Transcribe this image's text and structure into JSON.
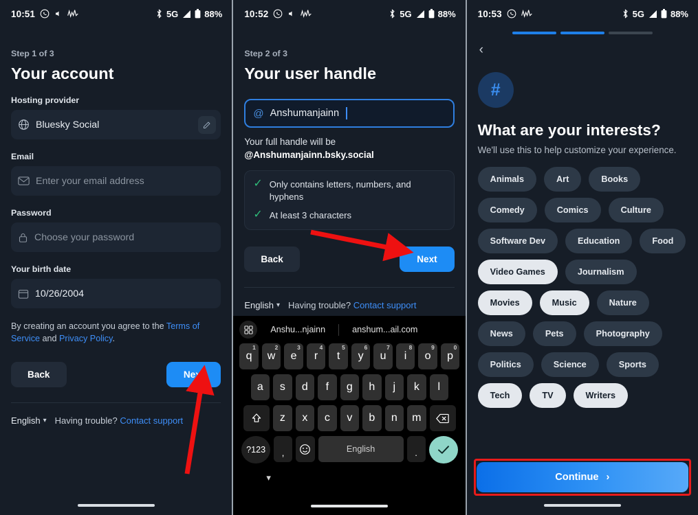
{
  "panels": [
    {
      "statusbar": {
        "time": "10:51",
        "left_icons": [
          "whatsapp-icon",
          "mute-icon",
          "pulse-icon"
        ],
        "network": "5G",
        "battery": "88%",
        "right_icons": [
          "bluetooth-icon",
          "signal-icon",
          "battery-icon"
        ]
      },
      "step": "Step 1 of 3",
      "title": "Your account",
      "fields": {
        "hosting_label": "Hosting provider",
        "hosting_value": "Bluesky Social",
        "email_label": "Email",
        "email_placeholder": "Enter your email address",
        "password_label": "Password",
        "password_placeholder": "Choose your password",
        "birth_label": "Your birth date",
        "birth_value": "10/26/2004"
      },
      "terms": {
        "prefix": "By creating an account you agree to the ",
        "tos": "Terms of Service",
        "middle": " and ",
        "privacy": "Privacy Policy",
        "suffix": "."
      },
      "back_label": "Back",
      "next_label": "Next",
      "footer": {
        "language": "English",
        "help": "Having trouble?",
        "contact": "Contact support"
      }
    },
    {
      "statusbar": {
        "time": "10:52",
        "left_icons": [
          "whatsapp-icon",
          "mute-icon",
          "pulse-icon"
        ],
        "network": "5G",
        "battery": "88%",
        "right_icons": [
          "bluetooth-icon",
          "signal-icon",
          "battery-icon"
        ]
      },
      "step": "Step 2 of 3",
      "title": "Your user handle",
      "handle_value": "Anshumanjainn",
      "full_handle_prefix": "Your full handle will be ",
      "full_handle_value": "@Anshumanjainn.bsky.social",
      "rules": [
        "Only contains letters, numbers, and hyphens",
        "At least 3 characters"
      ],
      "back_label": "Back",
      "next_label": "Next",
      "footer": {
        "language": "English",
        "help": "Having trouble?",
        "contact": "Contact support"
      },
      "keyboard": {
        "suggestions": [
          "Anshu...njainn",
          "anshum...ail.com"
        ],
        "row1": [
          {
            "k": "q",
            "n": "1"
          },
          {
            "k": "w",
            "n": "2"
          },
          {
            "k": "e",
            "n": "3"
          },
          {
            "k": "r",
            "n": "4"
          },
          {
            "k": "t",
            "n": "5"
          },
          {
            "k": "y",
            "n": "6"
          },
          {
            "k": "u",
            "n": "7"
          },
          {
            "k": "i",
            "n": "8"
          },
          {
            "k": "o",
            "n": "9"
          },
          {
            "k": "p",
            "n": "0"
          }
        ],
        "row2": [
          "a",
          "s",
          "d",
          "f",
          "g",
          "h",
          "j",
          "k",
          "l"
        ],
        "row3": [
          "z",
          "x",
          "c",
          "v",
          "b",
          "n",
          "m"
        ],
        "numeric_key": "?123",
        "comma_key": ",",
        "period_key": ".",
        "space_key": "English",
        "emoji_key": "emoji-icon",
        "shift_key": "shift-icon",
        "backspace_key": "backspace-icon",
        "enter_key": "checkmark-icon"
      }
    },
    {
      "statusbar": {
        "time": "10:53",
        "left_icons": [
          "whatsapp-icon",
          "pulse-icon"
        ],
        "network": "5G",
        "battery": "88%",
        "right_icons": [
          "bluetooth-icon",
          "signal-icon",
          "battery-icon"
        ]
      },
      "progress": [
        true,
        true,
        false
      ],
      "avatar_icon": "#",
      "title": "What are your interests?",
      "subtitle": "We'll use this to help customize your experience.",
      "interests": [
        {
          "label": "Animals",
          "selected": false
        },
        {
          "label": "Art",
          "selected": false
        },
        {
          "label": "Books",
          "selected": false
        },
        {
          "label": "Comedy",
          "selected": false
        },
        {
          "label": "Comics",
          "selected": false
        },
        {
          "label": "Culture",
          "selected": false
        },
        {
          "label": "Software Dev",
          "selected": false
        },
        {
          "label": "Education",
          "selected": false
        },
        {
          "label": "Food",
          "selected": false
        },
        {
          "label": "Video Games",
          "selected": true
        },
        {
          "label": "Journalism",
          "selected": false
        },
        {
          "label": "Movies",
          "selected": true
        },
        {
          "label": "Music",
          "selected": true
        },
        {
          "label": "Nature",
          "selected": false
        },
        {
          "label": "News",
          "selected": false
        },
        {
          "label": "Pets",
          "selected": false
        },
        {
          "label": "Photography",
          "selected": false
        },
        {
          "label": "Politics",
          "selected": false
        },
        {
          "label": "Science",
          "selected": false
        },
        {
          "label": "Sports",
          "selected": false
        },
        {
          "label": "Tech",
          "selected": true
        },
        {
          "label": "TV",
          "selected": true
        },
        {
          "label": "Writers",
          "selected": true
        }
      ],
      "continue_label": "Continue"
    }
  ],
  "annotations": {
    "highlight_color": "#e81b1b",
    "arrow_color": "#ee1111"
  }
}
